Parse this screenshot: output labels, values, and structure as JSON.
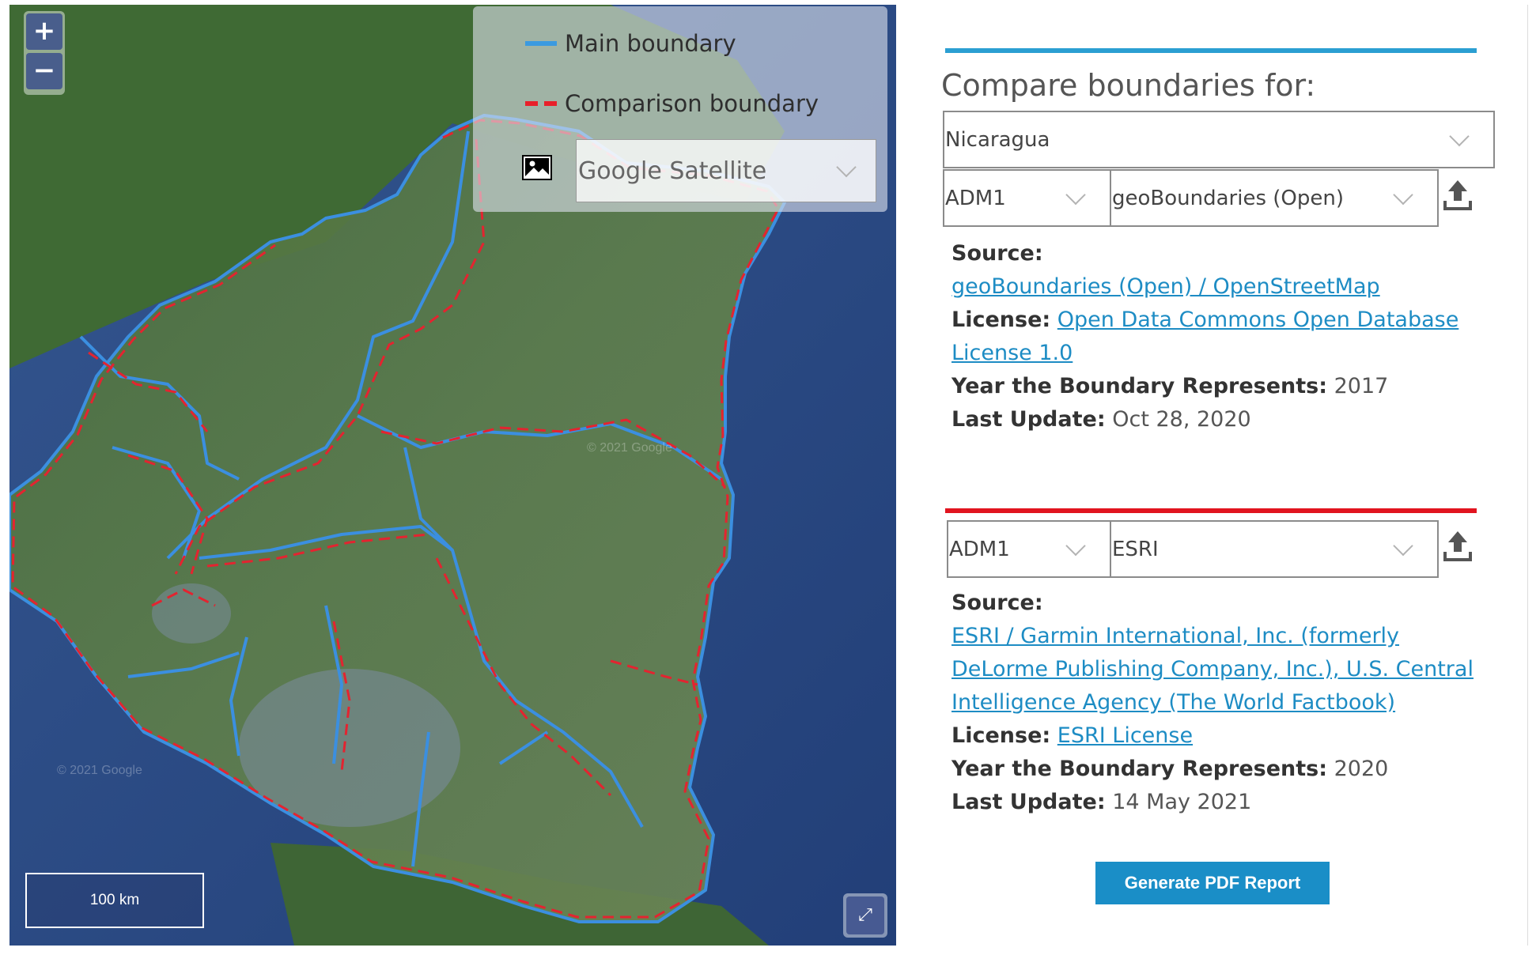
{
  "map": {
    "zoom_in": "+",
    "zoom_out": "−",
    "legend": {
      "main_label": "Main boundary",
      "comparison_label": "Comparison boundary",
      "main_color": "#3b9ae0",
      "comparison_color": "#e8202a"
    },
    "basemap_select": {
      "value": "Google Satellite",
      "icon": "image-icon"
    },
    "scale_label": "100 km",
    "fullscreen_icon": "expand-icon",
    "watermark": "© 2021 Google"
  },
  "panel": {
    "title": "Compare boundaries for:",
    "country_select": "Nicaragua",
    "main": {
      "color": "#2b9fd2",
      "level": "ADM1",
      "dataset": "geoBoundaries (Open)",
      "upload_icon": "upload-icon",
      "source_label": "Source:",
      "source_link": "geoBoundaries (Open) / OpenStreetMap",
      "license_label": "License:",
      "license_link": "Open Data Commons Open Database License 1.0",
      "year_label": "Year the Boundary Represents:",
      "year_value": "2017",
      "update_label": "Last Update:",
      "update_value": "Oct 28, 2020"
    },
    "comparison": {
      "color": "#e1141f",
      "level": "ADM1",
      "dataset": "ESRI",
      "upload_icon": "upload-icon",
      "source_label": "Source:",
      "source_link": "ESRI / Garmin International, Inc. (formerly DeLorme Publishing Company, Inc.), U.S. Central Intelligence Agency (The World Factbook)",
      "license_label": "License:",
      "license_link": "ESRI License",
      "year_label": "Year the Boundary Represents:",
      "year_value": "2020",
      "update_label": "Last Update:",
      "update_value": "14 May 2021"
    },
    "report_button": "Generate PDF Report"
  }
}
